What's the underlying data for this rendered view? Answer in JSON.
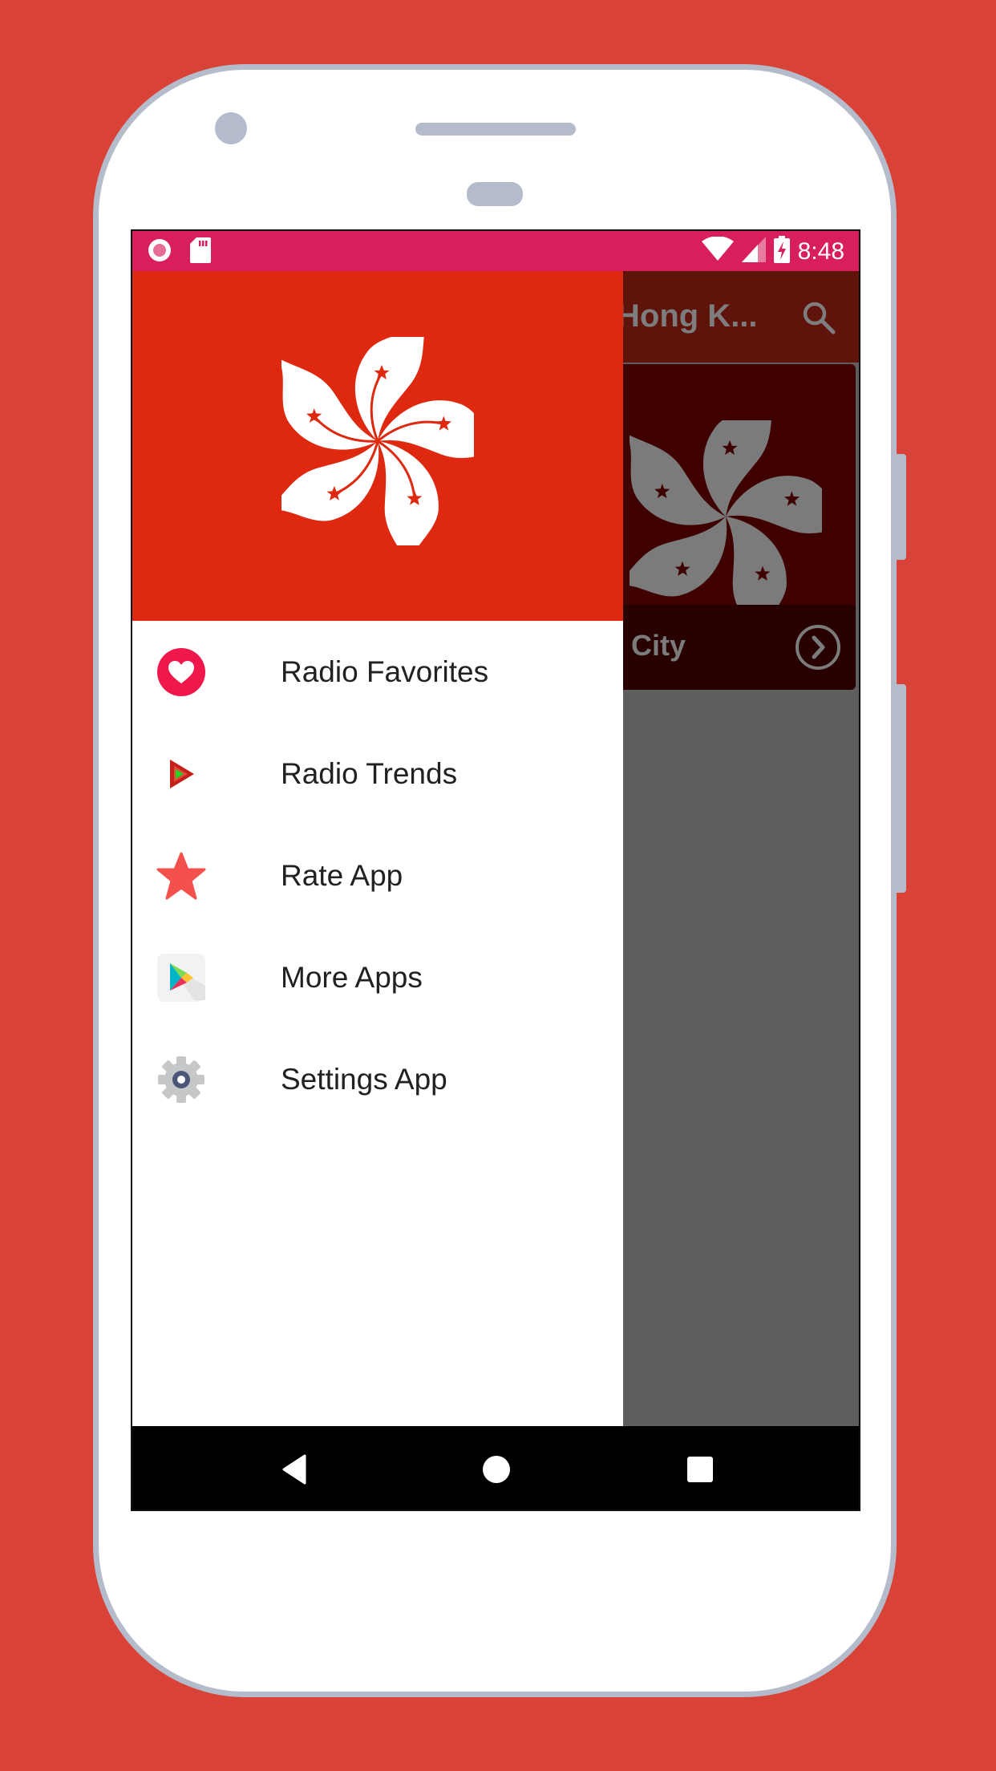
{
  "status_bar": {
    "time": "8:48",
    "left_icons": [
      "record-icon",
      "sd-card-icon"
    ],
    "right_icons": [
      "wifi-icon",
      "signal-icon",
      "battery-charging-icon"
    ]
  },
  "toolbar": {
    "title": "Hong K...",
    "search_icon": "search-icon"
  },
  "station_card": {
    "title": "City",
    "arrow_icon": "chevron-right-circle-icon"
  },
  "drawer": {
    "header_image": "hong-kong-flag-bauhinia",
    "items": [
      {
        "label": "Radio Favorites",
        "icon": "heart-icon"
      },
      {
        "label": "Radio Trends",
        "icon": "trends-play-icon"
      },
      {
        "label": "Rate App",
        "icon": "star-icon"
      },
      {
        "label": "More Apps",
        "icon": "google-play-icon"
      },
      {
        "label": "Settings App",
        "icon": "gear-icon"
      }
    ]
  },
  "nav_bar": {
    "back": "back-icon",
    "home": "home-icon",
    "recents": "recents-icon"
  },
  "colors": {
    "background": "#d94237",
    "status_bar": "#d81e5b",
    "drawer_header": "#de2910",
    "heart": "#f0174a",
    "star": "#f4504c"
  }
}
